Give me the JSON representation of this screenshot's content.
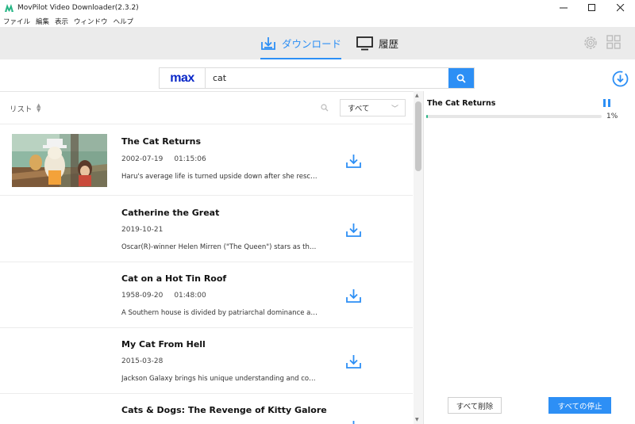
{
  "window": {
    "title": "MovPilot Video Downloader(2.3.2)",
    "controls": [
      "minimize-icon",
      "maximize-icon",
      "close-icon"
    ]
  },
  "menu": [
    "ファイル",
    "編集",
    "表示",
    "ウィンドウ",
    "ヘルプ"
  ],
  "nav": {
    "tabs": [
      {
        "label": "ダウンロード",
        "icon": "download-tray-icon",
        "active": true
      },
      {
        "label": "履歴",
        "icon": "monitor-icon",
        "active": false
      }
    ],
    "right_icons": [
      "gear-icon",
      "grid-icon"
    ]
  },
  "search": {
    "service_logo": "max",
    "query": "cat",
    "button_icon": "search-icon"
  },
  "list": {
    "label": "リスト",
    "filter_value": "すべて",
    "items": [
      {
        "title": "The Cat Returns",
        "date": "2002-07-19",
        "duration": "01:15:06",
        "description": "Haru's average life is turned upside down after she rescue...",
        "has_thumbnail": true
      },
      {
        "title": "Catherine the Great",
        "date": "2019-10-21",
        "duration": "",
        "description": "Oscar(R)-winner Helen Mirren (\"The Queen\") stars as the t...",
        "has_thumbnail": false
      },
      {
        "title": "Cat on a Hot Tin Roof",
        "date": "1958-09-20",
        "duration": "01:48:00",
        "description": "A Southern house is divided by patriarchal dominance an...",
        "has_thumbnail": false
      },
      {
        "title": "My Cat From Hell",
        "date": "2015-03-28",
        "duration": "",
        "description": "Jackson Galaxy brings his unique understanding and com...",
        "has_thumbnail": false
      },
      {
        "title": "Cats & Dogs: The Revenge of Kitty Galore",
        "date": "",
        "duration": "",
        "description": "",
        "has_thumbnail": false
      }
    ]
  },
  "task": {
    "title": "The Cat Returns",
    "progress_percent": 1,
    "progress_label": "1%"
  },
  "actions": {
    "clear_all": "すべて削除",
    "stop_all": "すべての停止"
  },
  "colors": {
    "accent": "#2d8ff5",
    "progress": "#26b585",
    "max_logo": "#0a28c8"
  }
}
